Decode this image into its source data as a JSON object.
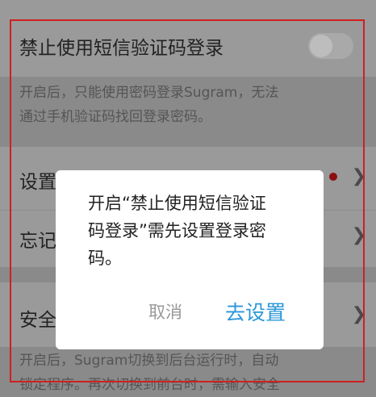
{
  "settings": {
    "disable_sms": {
      "label": "禁止使用短信验证码登录",
      "enabled": false
    },
    "disable_sms_desc": [
      "开启后，只能使用密码登录Sugram，无法",
      "通过手机验证码找回登录密码。"
    ],
    "set_item": {
      "label": "设置"
    },
    "forgot_item": {
      "label": "忘记"
    },
    "security_item": {
      "label": "安全"
    },
    "security_desc": [
      "开启后，Sugram切换到后台运行时，自动",
      "锁定程序。再次切换到前台时，需输入安全"
    ]
  },
  "dialog": {
    "message": "开启“禁止使用短信验证码登录”需先设置登录密码。",
    "cancel_label": "取消",
    "confirm_label": "去设置"
  },
  "colors": {
    "accent": "#2a97d8",
    "badge": "#d02020"
  }
}
